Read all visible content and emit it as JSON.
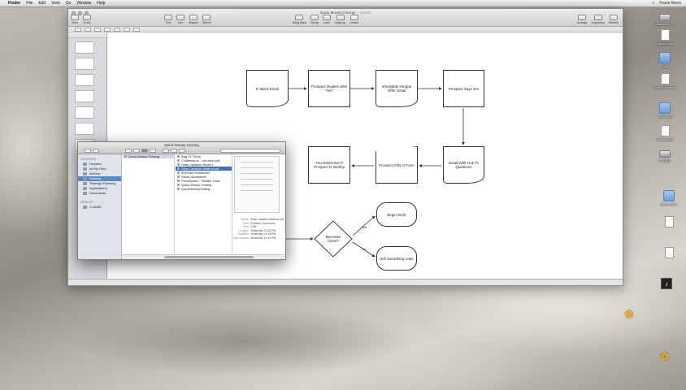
{
  "menubar": {
    "app": "Finder",
    "items": [
      "File",
      "Edit",
      "View",
      "Go",
      "Window",
      "Help"
    ],
    "user": "Frank Akers"
  },
  "app_window": {
    "title": "Quick Money Closing",
    "title_dimmed": "— Edited",
    "toolbar_left": [
      "View",
      "Zoom"
    ],
    "toolbar_mid": [
      "Text",
      "Line",
      "Shapes",
      "Stencil"
    ],
    "toolbar_center": [
      "Bring Back",
      "Group",
      "Lock",
      "Ungroup",
      "Unlock"
    ],
    "toolbar_right": [
      "Arrange",
      "Inspectors",
      "Stencils"
    ]
  },
  "flowchart": {
    "nodes": [
      {
        "id": "n1",
        "text": "E-Word Email",
        "shape": "document"
      },
      {
        "id": "n2",
        "text": "Prospect Replies With \"Yes\"",
        "shape": "process"
      },
      {
        "id": "n3",
        "text": "Irresistible Intrigue Offer Email",
        "shape": "document"
      },
      {
        "id": "n4",
        "text": "Prospect Says Yes",
        "shape": "process"
      },
      {
        "id": "n5",
        "text": "Email With Link To Questions",
        "shape": "document"
      },
      {
        "id": "n6",
        "text": "Prospect Fills in Form",
        "shape": "manual-input"
      },
      {
        "id": "n7",
        "text": "You Determine If Prospect Is Worthy",
        "shape": "process"
      },
      {
        "id": "n8",
        "text": "Becomes Client?",
        "shape": "decision"
      },
      {
        "id": "n9",
        "text": "Begin Work",
        "shape": "terminator"
      },
      {
        "id": "n10",
        "text": "Sell Something Later",
        "shape": "terminator"
      }
    ],
    "branch_yes": "Yes",
    "branch_no": "No"
  },
  "finder": {
    "title": "Quick Money Closing",
    "sidebar": {
      "favorites_label": "FAVORITES",
      "favorites": [
        "Dropbox",
        "All My Files",
        "AirDrop",
        "Desktop",
        "Strategic Planning",
        "Applications",
        "Documents"
      ],
      "selected": "Desktop",
      "devices_label": "DEVICES",
      "devices": [
        "C-BASE"
      ]
    },
    "column1": [
      "Quick Money Closing"
    ],
    "column2": [
      "Bag Of Tricks",
      "Collateral-w... owl-bars.pdf",
      "Dean Jackson Email 1",
      "Dean Jackson Method.pdf",
      "IB Email Worksheet",
      "Sticky Worksheet",
      "Prescription - Hidden Cash",
      "Quick Money Getting",
      "QuickMoneyGetting"
    ],
    "column2_selected": "Dean Jackson Method.pdf",
    "meta": [
      {
        "k": "Name",
        "v": "Dean Jackson Method.pdf"
      },
      {
        "k": "Kind",
        "v": "Portable Document"
      },
      {
        "k": "Size",
        "v": "5 KB"
      },
      {
        "k": "Created",
        "v": "Yesterday 12:43 PM"
      },
      {
        "k": "Modified",
        "v": "Yesterday 12:43 PM"
      },
      {
        "k": "Last opened",
        "v": "Yesterday 12:43 PM"
      }
    ]
  },
  "desktop_icons": [
    {
      "label": "Macintosh HD",
      "icon": "drive-icon"
    },
    {
      "label": "redirect.php",
      "icon": "document-icon"
    },
    {
      "label": "Stuff",
      "icon": "folder-icon"
    },
    {
      "label": "TradeTaskApps",
      "icon": "document-icon"
    },
    {
      "label": "SM Links",
      "icon": "folder-icon"
    },
    {
      "label": "NewReport",
      "icon": "document-icon"
    },
    {
      "label": "C-BASE",
      "icon": "drive-icon"
    },
    {
      "label": "New Folder",
      "icon": "folder-icon"
    },
    {
      "label": "",
      "icon": "document-icon"
    },
    {
      "label": "",
      "icon": "document-icon"
    },
    {
      "label": "",
      "icon": "music-icon"
    },
    {
      "label": "",
      "icon": "flower-icon"
    },
    {
      "label": "",
      "icon": "flower-icon"
    }
  ]
}
